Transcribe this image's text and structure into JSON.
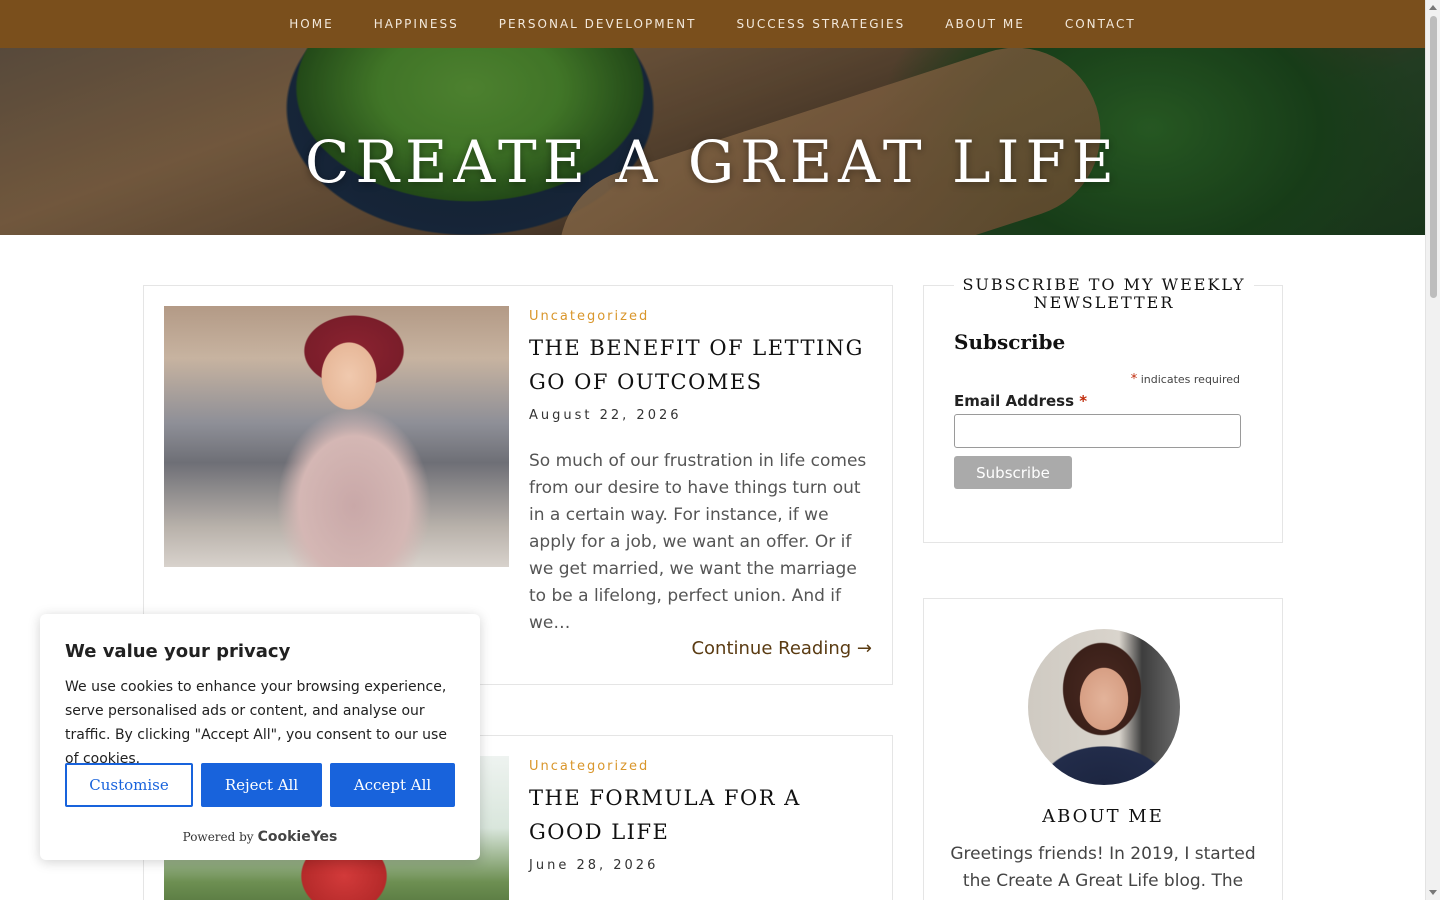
{
  "nav": {
    "items": [
      "HOME",
      "HAPPINESS",
      "PERSONAL DEVELOPMENT",
      "SUCCESS STRATEGIES",
      "ABOUT ME",
      "CONTACT"
    ]
  },
  "hero": {
    "title": "CREATE A GREAT LIFE"
  },
  "posts": [
    {
      "category": "Uncategorized",
      "title": "THE BENEFIT OF LETTING GO OF OUTCOMES",
      "date": "August 22, 2026",
      "excerpt": "So much of our frustration in life comes from our desire to have things turn out in a certain way.  For instance, if we apply for a job, we want an offer.  Or if we get married, we want the marriage to be a lifelong, perfect union.  And if we…",
      "more": "Continue Reading →"
    },
    {
      "category": "Uncategorized",
      "title": "THE FORMULA FOR A GOOD LIFE",
      "date": "June 28, 2026"
    }
  ],
  "newsletter": {
    "widget_title": "SUBSCRIBE TO MY WEEKLY NEWSLETTER",
    "heading": "Subscribe",
    "required_mark": "*",
    "required_note": "indicates required",
    "email_label": "Email Address",
    "email_value": "",
    "button": "Subscribe"
  },
  "about": {
    "title": "ABOUT ME",
    "body": "Greetings friends! In 2019, I started the Create A Great Life blog. The"
  },
  "cookie": {
    "title": "We value your privacy",
    "body": "We use cookies to enhance your browsing experience, serve personalised ads or content, and analyse our traffic. By clicking \"Accept All\", you consent to our use of cookies.",
    "customise": "Customise",
    "reject": "Reject All",
    "accept": "Accept All",
    "powered_by": "Powered by",
    "brand": "CookieYes"
  },
  "colors": {
    "nav_bg": "#7a4f1c",
    "category": "#d9962b",
    "cookie_blue": "#1863dc"
  }
}
